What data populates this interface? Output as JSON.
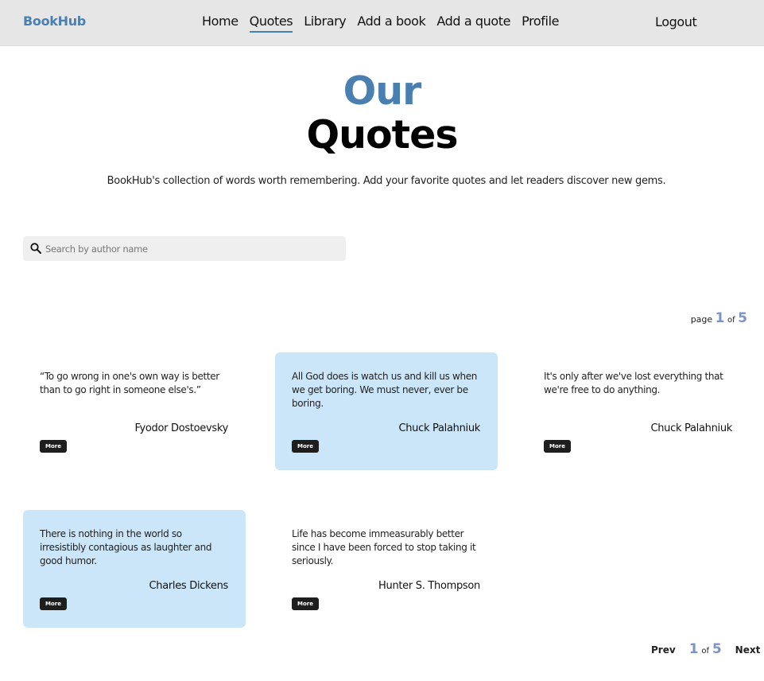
{
  "nav": {
    "brand": "BookHub",
    "links": [
      "Home",
      "Quotes",
      "Library",
      "Add a book",
      "Add a quote",
      "Profile"
    ],
    "logout": "Logout"
  },
  "hero": {
    "accent": "Our",
    "title": "Quotes",
    "subtitle": "BookHub's collection of words worth remembering. Add your favorite quotes and let readers discover new gems."
  },
  "search": {
    "placeholder": "Search by author name",
    "value": ""
  },
  "pagination": {
    "page_label": "page",
    "current": "1",
    "of_label": "of",
    "total": "5",
    "prev": "Prev",
    "next": "Next"
  },
  "quotes": [
    {
      "text": "“To go wrong in one's own way is better than to go right in someone else's.”",
      "author": "Fyodor Dostoevsky",
      "more": "More"
    },
    {
      "text": "All God does is watch us and kill us when we get boring. We must never, ever be boring.",
      "author": "Chuck Palahniuk",
      "more": "More"
    },
    {
      "text": "It's only after we've lost everything that we're free to do anything.",
      "author": "Chuck Palahniuk",
      "more": "More"
    },
    {
      "text": "There is nothing in the world so irresistibly contagious as laughter and good humor.",
      "author": "Charles Dickens",
      "more": "More"
    },
    {
      "text": "Life has become immeasurably better since I have been forced to stop taking it seriously.",
      "author": "Hunter S. Thompson",
      "more": "More"
    }
  ],
  "colors": {
    "accent": "#4a7fb2",
    "highlight_card": "#cbe6f8",
    "page_number": "#7d93c8",
    "nav_bg": "#e6e6e6"
  },
  "icons": {
    "search": "search-icon"
  }
}
